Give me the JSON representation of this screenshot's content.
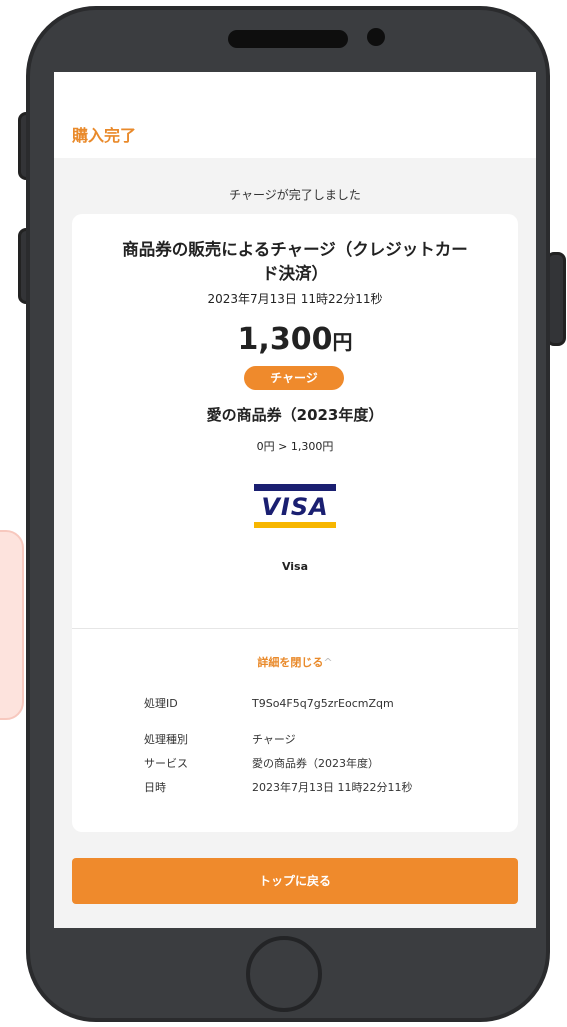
{
  "header": {
    "title": "購入完了"
  },
  "notice": "チャージが完了しました",
  "transaction": {
    "title_line1": "商品券の販売によるチャージ（クレジットカー",
    "title_line2": "ド決済）",
    "datetime": "2023年7月13日 11時22分11秒",
    "amount": "1,300",
    "currency": "円",
    "badge": "チャージ",
    "service": "愛の商品券（2023年度）",
    "balance": "0円 > 1,300円",
    "card_logo_text": "VISA",
    "card_brand": "Visa"
  },
  "details": {
    "toggle_label": "詳細を閉じる",
    "toggle_icon": "^",
    "rows": [
      {
        "label": "処理ID",
        "value": "T9So4F5q7g5zrEocmZqm"
      },
      {
        "label": "処理種別",
        "value": "チャージ"
      },
      {
        "label": "サービス",
        "value": "愛の商品券（2023年度）"
      },
      {
        "label": "日時",
        "value": "2023年7月13日 11時22分11秒"
      }
    ]
  },
  "actions": {
    "back_to_top": "トップに戻る"
  },
  "colors": {
    "accent": "#ef8a2c",
    "visa_blue": "#1a1f71",
    "visa_gold": "#f7b600",
    "phone_body": "#3b3d40"
  }
}
